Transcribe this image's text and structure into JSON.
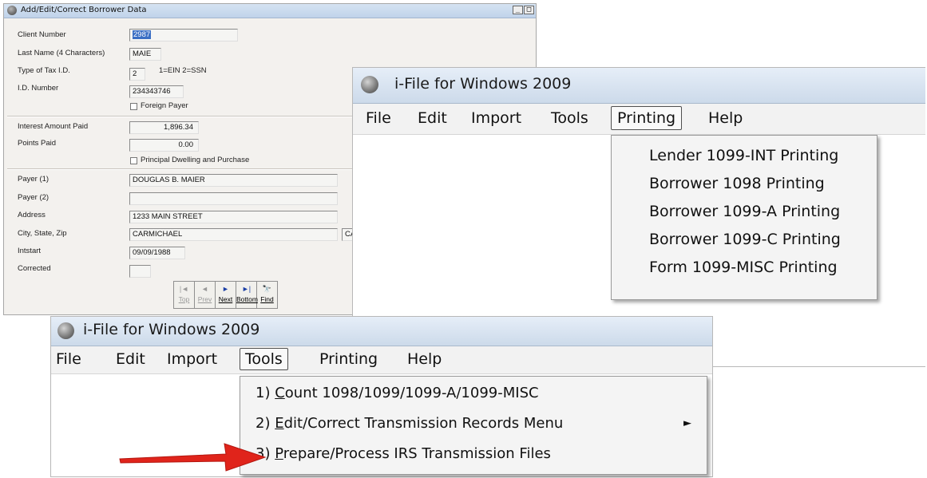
{
  "borrower_window": {
    "title": "Add/Edit/Correct Borrower Data",
    "title_buttons": [
      "_",
      "□"
    ],
    "labels": {
      "client_number": "Client Number",
      "last_name": "Last Name (4 Characters)",
      "tax_id_type": "Type of Tax I.D.",
      "id_number": "I.D. Number",
      "interest_amount": "Interest Amount Paid",
      "points_paid": "Points Paid",
      "payer1": "Payer (1)",
      "payer2": "Payer (2)",
      "address": "Address",
      "city_state_zip": "City, State, Zip",
      "intstart": "Intstart",
      "corrected": "Corrected"
    },
    "values": {
      "client_number": "2987",
      "last_name": "MAIE",
      "tax_id_type": "2",
      "tax_id_hint": "1=EIN  2=SSN",
      "id_number": "234343746",
      "interest_amount": "1,896.34",
      "points_paid": "0.00",
      "payer1": "DOUGLAS B. MAIER",
      "payer2": "",
      "address": "1233 MAIN STREET",
      "city": "CARMICHAEL",
      "state": "CA",
      "intstart": "09/09/1988",
      "corrected": ""
    },
    "checkboxes": {
      "foreign_payer": "Foreign Payer",
      "principal_dwelling": "Principal Dwelling and Purchase"
    },
    "nav_buttons": [
      {
        "icon": "|◄",
        "label": "Top"
      },
      {
        "icon": "◄",
        "label": "Prev"
      },
      {
        "icon": "►",
        "label": "Next"
      },
      {
        "icon": "►|",
        "label": "Bottom"
      },
      {
        "icon": "🔭",
        "label": "Find"
      }
    ]
  },
  "printing_window": {
    "title": "i-File for Windows 2009",
    "menu": [
      "File",
      "Edit",
      "Import",
      "Tools",
      "Printing",
      "Help"
    ],
    "open_menu": "Printing",
    "dropdown": [
      "Lender 1099-INT Printing",
      "Borrower 1098 Printing",
      "Borrower 1099-A Printing",
      "Borrower 1099-C Printing",
      "Form 1099-MISC Printing"
    ]
  },
  "tools_window": {
    "title": "i-File for Windows 2009",
    "menu": [
      "File",
      "Edit",
      "Import",
      "Tools",
      "Printing",
      "Help"
    ],
    "open_menu": "Tools",
    "dropdown": [
      {
        "prefix": "1) ",
        "mnemonic": "C",
        "rest": "ount 1098/1099/1099-A/1099-MISC",
        "submenu": false
      },
      {
        "prefix": "2)  ",
        "mnemonic": "E",
        "rest": "dit/Correct Transmission Records Menu",
        "submenu": true,
        "submenu_arrow": "►"
      },
      {
        "prefix": "3) ",
        "mnemonic": "P",
        "rest": "repare/Process IRS Transmission Files",
        "submenu": false
      }
    ]
  },
  "colors": {
    "arrow": "#e0241b",
    "title_gradient_top": "#e6eef8",
    "title_gradient_bottom": "#ccdaea",
    "selection": "#3a6fc4"
  }
}
